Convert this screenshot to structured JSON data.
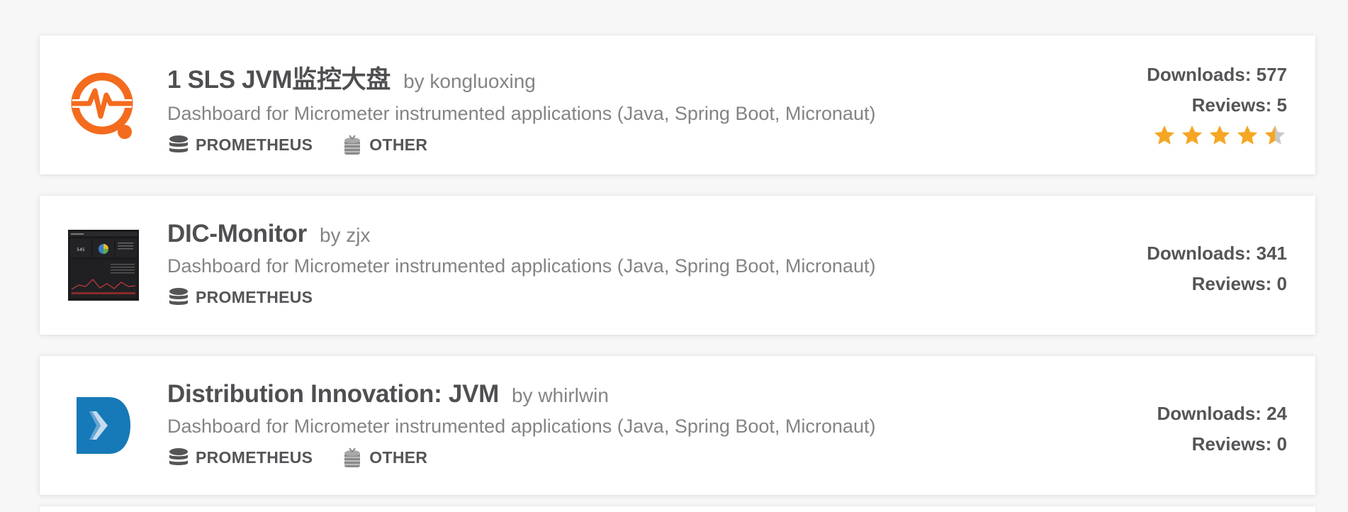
{
  "accent_orange": "#f46b1d",
  "star_color": "#f5a623",
  "cards": [
    {
      "title": "1 SLS JVM监控大盘",
      "author": "by kongluoxing",
      "description": "Dashboard for Micrometer instrumented applications (Java, Spring Boot, Micronaut)",
      "logo": "heartbeat-magnifier-icon",
      "tags": [
        {
          "icon": "database-icon",
          "label": "PROMETHEUS"
        },
        {
          "icon": "coin-stack-icon",
          "label": "OTHER"
        }
      ],
      "downloads": "Downloads: 577",
      "reviews": "Reviews: 5",
      "rating": 4.5
    },
    {
      "title": "DIC-Monitor",
      "author": "by zjx",
      "description": "Dashboard for Micrometer instrumented applications (Java, Spring Boot, Micronaut)",
      "logo": "dashboard-thumbnail",
      "tags": [
        {
          "icon": "database-icon",
          "label": "PROMETHEUS"
        }
      ],
      "downloads": "Downloads: 341",
      "reviews": "Reviews: 0"
    },
    {
      "title": "Distribution Innovation: JVM",
      "author": "by whirlwin",
      "description": "Dashboard for Micrometer instrumented applications (Java, Spring Boot, Micronaut)",
      "logo": "blue-chevron-logo",
      "tags": [
        {
          "icon": "database-icon",
          "label": "PROMETHEUS"
        },
        {
          "icon": "coin-stack-icon",
          "label": "OTHER"
        }
      ],
      "downloads": "Downloads: 24",
      "reviews": "Reviews: 0"
    }
  ]
}
